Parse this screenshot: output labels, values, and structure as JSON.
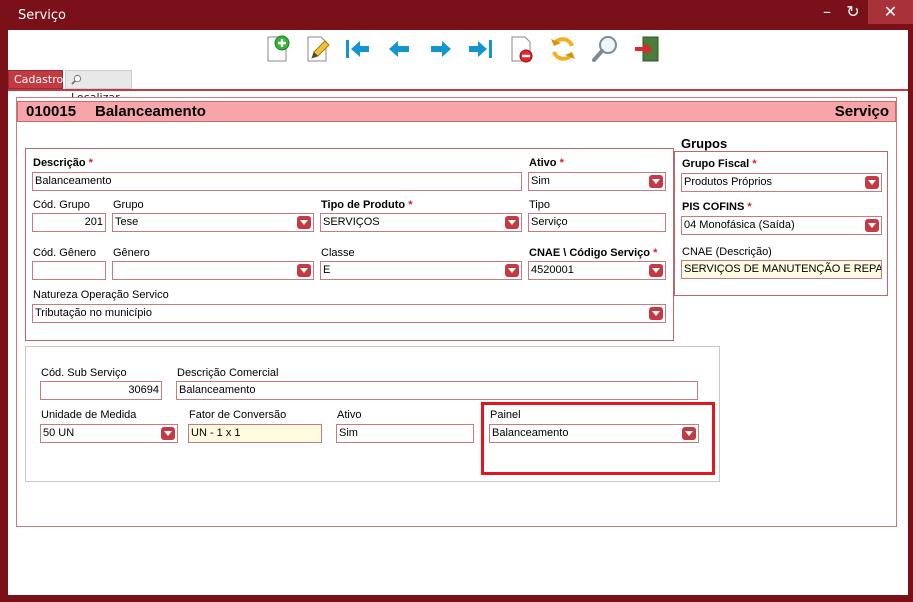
{
  "window": {
    "title": "Serviço"
  },
  "titlebar_buttons": {
    "minimize": "–",
    "refresh": "↻",
    "close": "✕"
  },
  "toolbar": {
    "icons": [
      "new-document-icon",
      "edit-icon",
      "first-record-icon",
      "previous-record-icon",
      "next-record-icon",
      "last-record-icon",
      "delete-document-icon",
      "refresh-icon",
      "search-icon",
      "exit-icon"
    ]
  },
  "tabs": {
    "cadastro": "Cadastro",
    "localizar": "Localizar"
  },
  "header": {
    "code": "010015",
    "name": "Balanceamento",
    "module": "Serviço"
  },
  "main": {
    "descricao": {
      "label": "Descrição",
      "req": "*",
      "value": "Balanceamento"
    },
    "ativo": {
      "label": "Ativo",
      "req": "*",
      "value": "Sim"
    },
    "cod_grupo": {
      "label": "Cód. Grupo",
      "value": "201"
    },
    "grupo": {
      "label": "Grupo",
      "value": "Tese"
    },
    "tipo_produto": {
      "label": "Tipo de Produto",
      "req": "*",
      "value": "SERVIÇOS"
    },
    "tipo": {
      "label": "Tipo",
      "value": "Serviço"
    },
    "cod_genero": {
      "label": "Cód. Gênero",
      "value": ""
    },
    "genero": {
      "label": "Gênero",
      "value": ""
    },
    "classe": {
      "label": "Classe",
      "value": "E"
    },
    "cnae_codigo": {
      "label": "CNAE \\ Código Serviço",
      "req": "*",
      "value": "4520001"
    },
    "natureza": {
      "label": "Natureza Operação Servico",
      "value": "Tributação no município"
    }
  },
  "grupos": {
    "title": "Grupos",
    "grupo_fiscal": {
      "label": "Grupo Fiscal",
      "req": "*",
      "value": "Produtos Próprios"
    },
    "pis_cofins": {
      "label": "PIS COFINS",
      "req": "*",
      "value": "04 Monofásica (Saída)"
    },
    "cnae_descricao": {
      "label": "CNAE (Descrição)",
      "value": "SERVIÇOS DE MANUTENÇÃO E REPARAÇÃO"
    }
  },
  "sub": {
    "cod_sub_servico": {
      "label": "Cód. Sub Serviço",
      "value": "30694"
    },
    "descricao_comercial": {
      "label": "Descrição Comercial",
      "value": "Balanceamento"
    },
    "unidade_medida": {
      "label": "Unidade de Medida",
      "value": "50 UN"
    },
    "fator_conversao": {
      "label": "Fator de Conversão",
      "value": "UN - 1 x 1"
    },
    "ativo": {
      "label": "Ativo",
      "value": "Sim"
    },
    "painel": {
      "label": "Painel",
      "value": "Balanceamento"
    }
  },
  "colors": {
    "accent": "#c23a44",
    "frame": "#7a1118",
    "header_bg": "#f7a5a9",
    "highlight": "#e0151d"
  }
}
